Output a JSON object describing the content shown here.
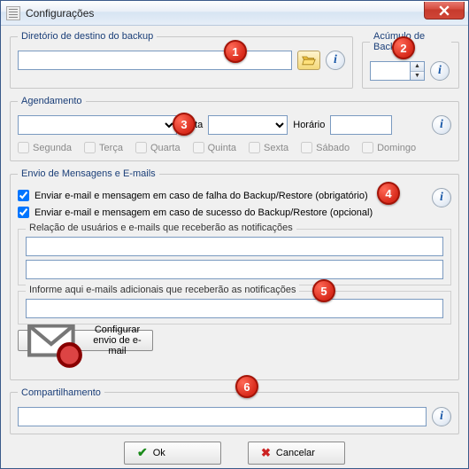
{
  "window": {
    "title": "Configurações"
  },
  "backup_dir": {
    "legend": "Diretório de destino do backup",
    "value": ""
  },
  "accum": {
    "legend": "Acúmulo de Backup's",
    "value": ""
  },
  "schedule": {
    "legend": "Agendamento",
    "freq_value": "",
    "data_label": "Data",
    "data_value": "",
    "horario_label": "Horário",
    "horario_value": "",
    "days": [
      {
        "label": "Segunda",
        "checked": false
      },
      {
        "label": "Terça",
        "checked": false
      },
      {
        "label": "Quarta",
        "checked": false
      },
      {
        "label": "Quinta",
        "checked": false
      },
      {
        "label": "Sexta",
        "checked": false
      },
      {
        "label": "Sábado",
        "checked": false
      },
      {
        "label": "Domingo",
        "checked": false
      }
    ]
  },
  "messaging": {
    "legend": "Envio de Mensagens e E-mails",
    "chk_fail_label": "Enviar e-mail e mensagem em caso de falha do Backup/Restore  (obrigatório)",
    "chk_fail_checked": true,
    "chk_ok_label": "Enviar e-mail e mensagem em caso de sucesso do Backup/Restore (opcional)",
    "chk_ok_checked": true,
    "sub1_legend": "Relação de usuários e e-mails que receberão as notificações",
    "sub1_line1": "",
    "sub1_line2": "",
    "sub2_legend": "Informe aqui e-mails adicionais que receberão as notificações",
    "sub2_value": "",
    "config_email_btn": "Configurar envio de e-mail"
  },
  "share": {
    "legend": "Compartilhamento",
    "value": ""
  },
  "buttons": {
    "ok": "Ok",
    "cancel": "Cancelar"
  },
  "markers": [
    "1",
    "2",
    "3",
    "4",
    "5",
    "6"
  ],
  "info_glyph": "i"
}
